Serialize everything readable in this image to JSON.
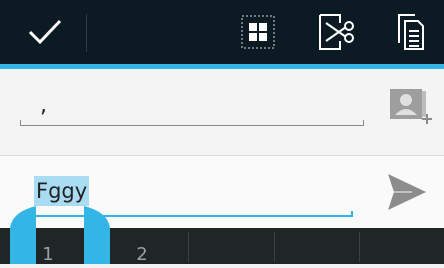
{
  "action_mode": {
    "done_icon": "checkmark-icon",
    "select_all_icon": "select-all-icon",
    "cut_icon": "cut-icon",
    "copy_icon": "copy-icon"
  },
  "recipients": {
    "value": ",",
    "add_contact_icon": "add-contact-icon"
  },
  "compose": {
    "message": "Fggy",
    "send_icon": "send-icon"
  },
  "keyboard": {
    "keys": [
      "1",
      "2",
      "",
      "",
      ""
    ]
  },
  "colors": {
    "actionbar_bg": "#0c1a23",
    "accent": "#33b5e5",
    "selection": "#a9dcf2",
    "keyboard_bg": "#202526"
  }
}
